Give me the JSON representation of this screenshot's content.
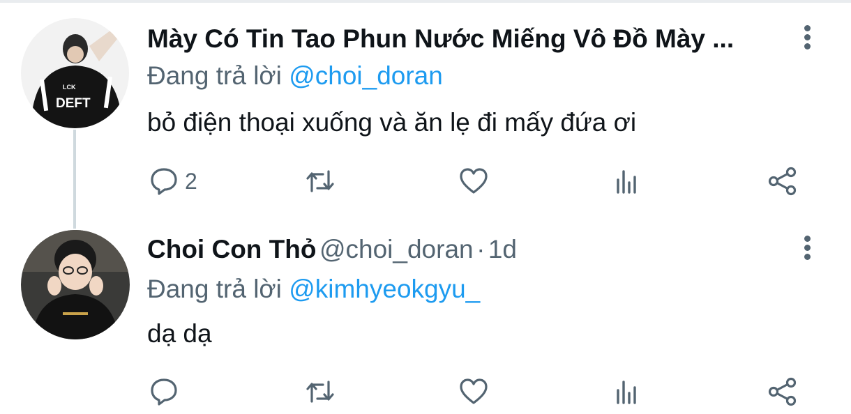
{
  "tweets": [
    {
      "display_name": "Mày Có Tin Tao Phun Nước Miếng Vô Đồ Mày ...",
      "reply_prefix": "Đang trả lời",
      "reply_mention": "@choi_doran",
      "text": "bỏ điện thoại xuống và ăn lẹ đi mấy đứa ơi",
      "reply_count": "2",
      "avatar_jacket_text": "DEFT"
    },
    {
      "display_name": "Choi Con Thỏ",
      "handle": "@choi_doran",
      "separator": "·",
      "time": "1d",
      "reply_prefix": "Đang trả lời",
      "reply_mention": "@kimhyeokgyu_",
      "text": "dạ dạ",
      "reply_count": ""
    }
  ],
  "colors": {
    "text": "#0f1419",
    "secondary": "#536471",
    "link": "#1d9bf0",
    "thread_line": "#cfd9de"
  },
  "icons": [
    "reply-icon",
    "retweet-icon",
    "like-icon",
    "views-icon",
    "share-icon",
    "more-options-icon"
  ]
}
